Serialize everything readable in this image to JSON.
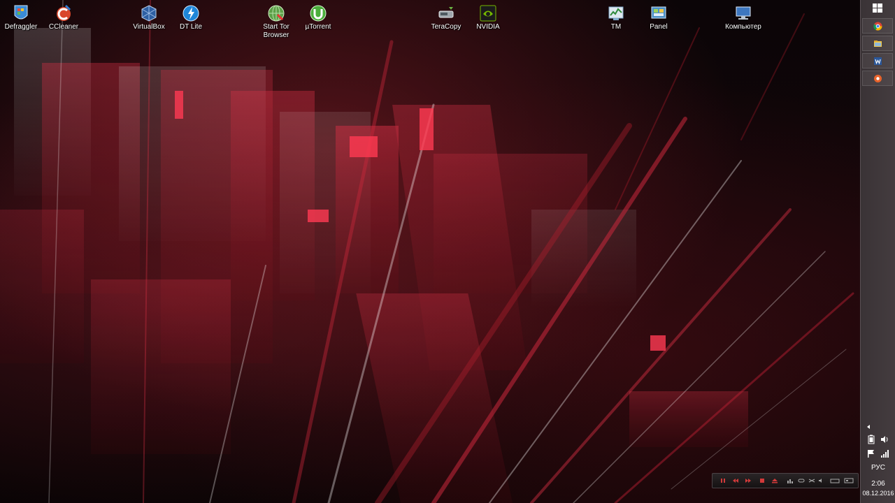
{
  "desktop": {
    "icons": [
      {
        "id": "defraggler",
        "label": "Defraggler",
        "icon": "defraggler-icon",
        "color": "#3a8bd6"
      },
      {
        "id": "ccleaner",
        "label": "CCleaner",
        "icon": "ccleaner-icon",
        "color": "#d9462b"
      },
      {
        "id": "virtualbox",
        "label": "VirtualBox",
        "icon": "virtualbox-icon",
        "color": "#2d5fa3"
      },
      {
        "id": "dtlite",
        "label": "DT Lite",
        "icon": "daemon-tools-icon",
        "color": "#1f86d8"
      },
      {
        "id": "tor",
        "label_line1": "Start Tor",
        "label_line2": "Browser",
        "icon": "tor-browser-icon",
        "color": "#5ca048"
      },
      {
        "id": "utorrent",
        "label": "µTorrent",
        "icon": "utorrent-icon",
        "color": "#4cae3c"
      },
      {
        "id": "teracopy",
        "label": "TeraCopy",
        "icon": "teracopy-icon",
        "color": "#9fa7ad"
      },
      {
        "id": "nvidia",
        "label": "NVIDIA",
        "icon": "nvidia-icon",
        "color": "#76b900"
      },
      {
        "id": "tm",
        "label": "TM",
        "icon": "task-manager-icon",
        "color": "#7fa8c9"
      },
      {
        "id": "panel",
        "label": "Panel",
        "icon": "control-panel-icon",
        "color": "#4a90c8"
      },
      {
        "id": "computer",
        "label": "Компьютер",
        "icon": "computer-icon",
        "color": "#3d77c0"
      }
    ]
  },
  "taskbar": {
    "pinned": [
      {
        "id": "chrome",
        "icon": "chrome-icon"
      },
      {
        "id": "explorer",
        "icon": "file-explorer-icon"
      },
      {
        "id": "word",
        "icon": "word-icon"
      },
      {
        "id": "settings",
        "icon": "gear-icon"
      }
    ],
    "tray": {
      "language": "РУС",
      "time": "2:06",
      "date": "08.12.2016"
    }
  },
  "colors": {
    "taskbar_bg": "#3e3639",
    "wallpaper_accent": "#c21f32"
  }
}
